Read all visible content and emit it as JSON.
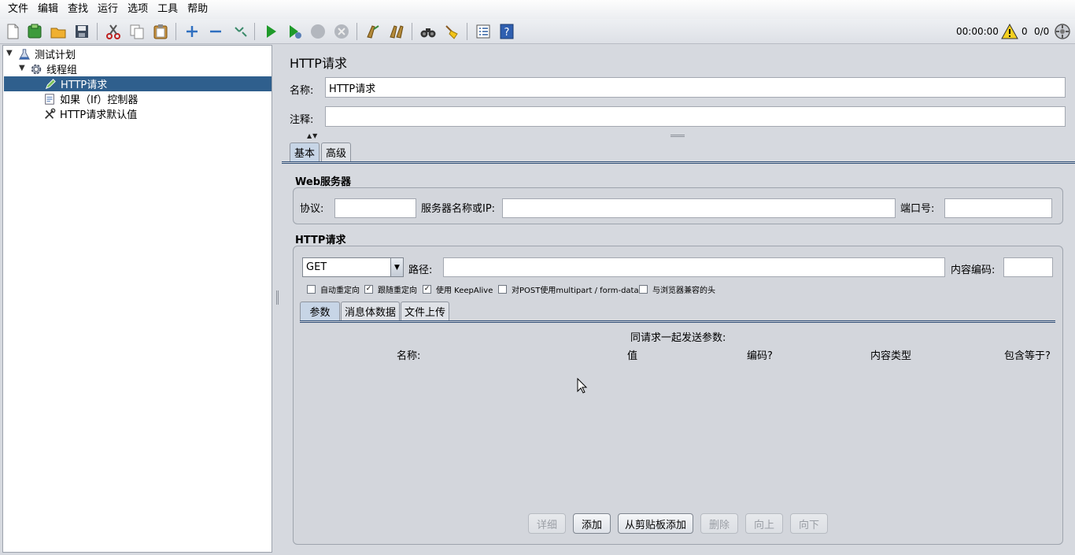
{
  "menu": [
    "文件",
    "编辑",
    "查找",
    "运行",
    "选项",
    "工具",
    "帮助"
  ],
  "toolbar": {
    "icons": [
      "new-icon",
      "templates-icon",
      "open-icon",
      "save-icon",
      "cut-icon",
      "copy-icon",
      "paste-icon",
      "expand-icon",
      "collapse-icon",
      "toggle-icon",
      "start-icon",
      "start-no-pause-icon",
      "stop-icon",
      "shutdown-icon",
      "clear-icon",
      "clear-all-icon",
      "search-icon",
      "reset-search-icon",
      "function-helper-icon",
      "help-icon"
    ],
    "timer": "00:00:00",
    "warnings": "0",
    "threads": "0/0"
  },
  "tree": {
    "items": [
      {
        "label": "测试计划",
        "icon": "test-plan-icon"
      },
      {
        "label": "线程组",
        "icon": "thread-group-icon"
      },
      {
        "label": "HTTP请求",
        "icon": "http-sampler-icon"
      },
      {
        "label": "如果（If）控制器",
        "icon": "if-controller-icon"
      },
      {
        "label": "HTTP请求默认值",
        "icon": "http-defaults-icon"
      }
    ]
  },
  "panel": {
    "title": "HTTP请求",
    "name_label": "名称:",
    "name_value": "HTTP请求",
    "comment_label": "注释:",
    "comment_value": "",
    "tabs": [
      "基本",
      "高级"
    ],
    "web_server": {
      "title": "Web服务器",
      "protocol_label": "协议:",
      "server_label": "服务器名称或IP:",
      "port_label": "端口号:"
    },
    "http_request": {
      "title": "HTTP请求",
      "method": "GET",
      "path_label": "路径:",
      "encoding_label": "内容编码:",
      "checkboxes": [
        {
          "label": "自动重定向",
          "checked": false
        },
        {
          "label": "跟随重定向",
          "checked": true
        },
        {
          "label": "使用 KeepAlive",
          "checked": true
        },
        {
          "label": "对POST使用multipart / form-data",
          "checked": false
        },
        {
          "label": "与浏览器兼容的头",
          "checked": false
        }
      ]
    },
    "sub_tabs": [
      "参数",
      "消息体数据",
      "文件上传"
    ],
    "params": {
      "caption": "同请求一起发送参数:",
      "columns": [
        "名称:",
        "值",
        "编码?",
        "内容类型",
        "包含等于?"
      ]
    },
    "buttons": {
      "detail": "详细",
      "add": "添加",
      "add_clipboard": "从剪贴板添加",
      "delete": "删除",
      "up": "向上",
      "down": "向下"
    }
  }
}
